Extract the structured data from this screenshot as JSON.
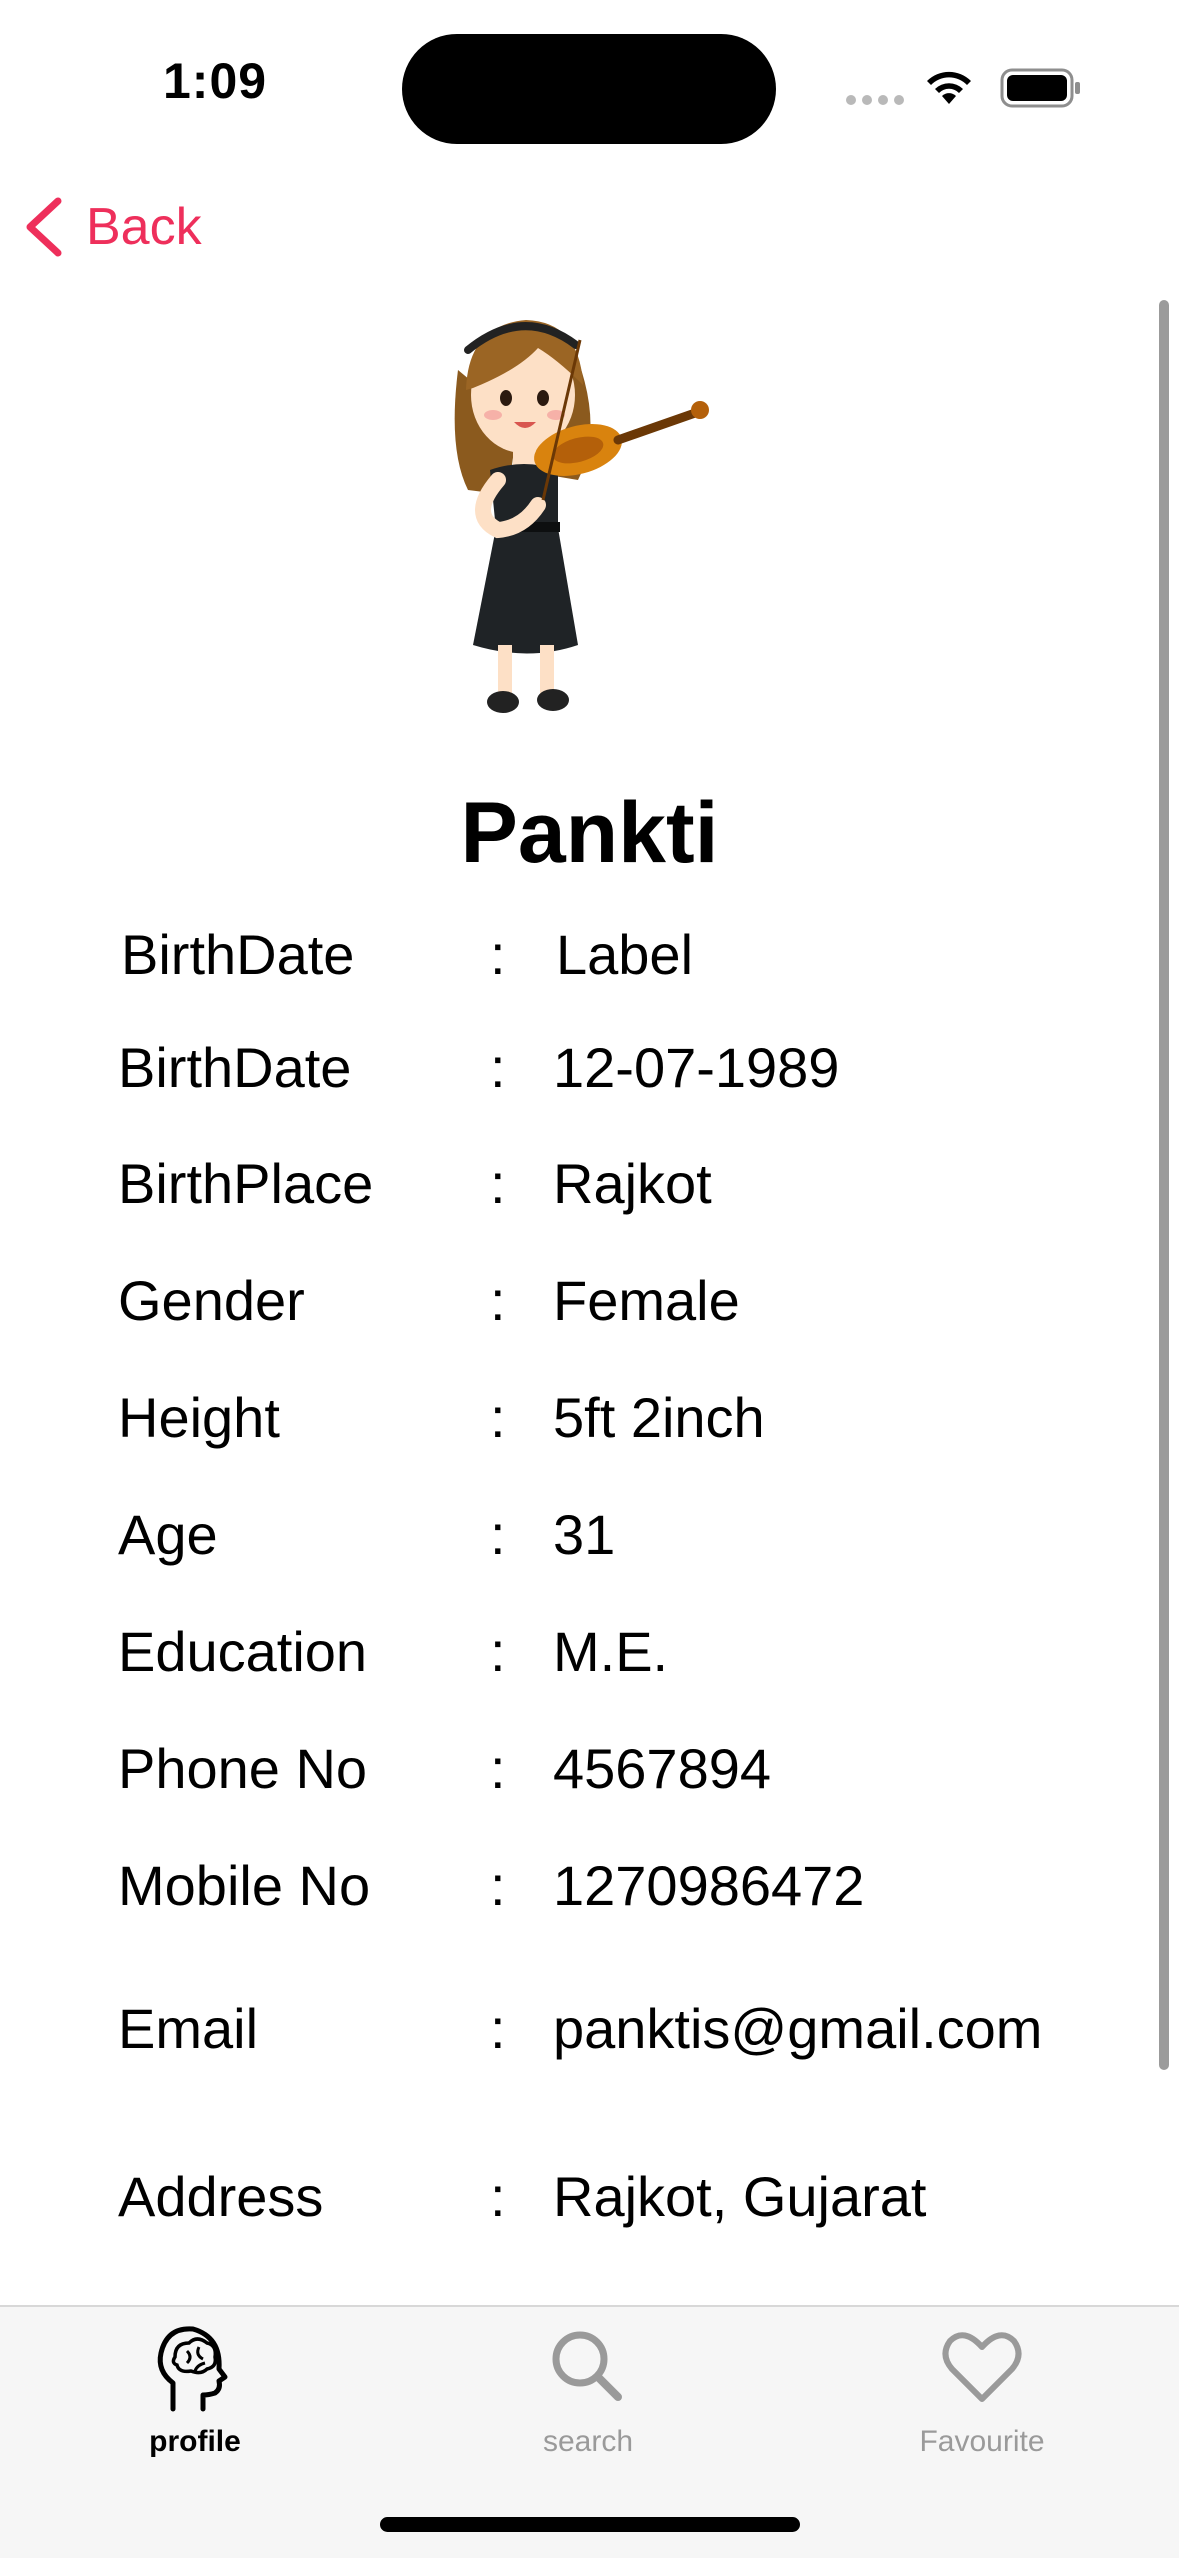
{
  "status_bar": {
    "time": "1:09"
  },
  "nav": {
    "back_label": "Back"
  },
  "profile": {
    "name": "Pankti",
    "details": [
      {
        "label": "BirthDate",
        "value": "Label"
      },
      {
        "label": "BirthDate",
        "value": "12-07-1989"
      },
      {
        "label": "BirthPlace",
        "value": "Rajkot"
      },
      {
        "label": "Gender",
        "value": "Female"
      },
      {
        "label": "Height",
        "value": "5ft 2inch"
      },
      {
        "label": "Age",
        "value": "31"
      },
      {
        "label": "Education",
        "value": "M.E."
      },
      {
        "label": "Phone No",
        "value": "4567894"
      },
      {
        "label": "Mobile No",
        "value": "1270986472"
      },
      {
        "label": "Email",
        "value": "panktis@gmail.com"
      },
      {
        "label": "Address",
        "value": "Rajkot, Gujarat"
      }
    ],
    "separator": ":"
  },
  "tab_bar": {
    "tabs": [
      {
        "label": "profile",
        "icon": "brain-head-icon",
        "active": true
      },
      {
        "label": "search",
        "icon": "search-icon",
        "active": false
      },
      {
        "label": "Favourite",
        "icon": "heart-icon",
        "active": false
      }
    ]
  },
  "colors": {
    "accent": "#ee2f5b",
    "tab_inactive": "#9a9a9a",
    "tab_bar_bg": "#f6f6f6"
  }
}
